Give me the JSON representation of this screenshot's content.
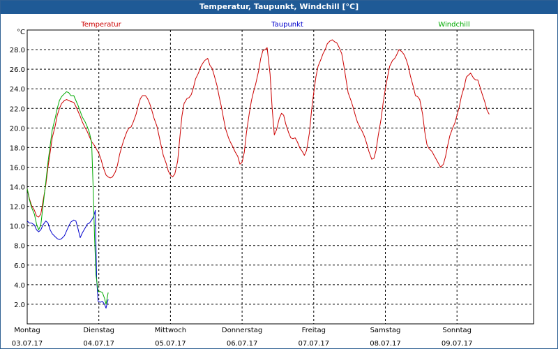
{
  "window": {
    "title": "Temperatur, Taupunkt, Windchill [°C]"
  },
  "chart_data": {
    "type": "line",
    "title": "Temperatur, Taupunkt, Windchill [°C]",
    "ylabel": "°C",
    "ylim": [
      0,
      30
    ],
    "xlim": [
      0,
      7
    ],
    "grid": true,
    "legend_position": "top",
    "y_ticks": [
      "2.0",
      "4.0",
      "6.0",
      "8.0",
      "10.0",
      "12.0",
      "14.0",
      "16.0",
      "18.0",
      "20.0",
      "22.0",
      "24.0",
      "26.0",
      "28.0"
    ],
    "x_ticks": [
      {
        "day": "Montag",
        "date": "03.07.17"
      },
      {
        "day": "Dienstag",
        "date": "04.07.17"
      },
      {
        "day": "Mittwoch",
        "date": "05.07.17"
      },
      {
        "day": "Donnerstag",
        "date": "06.07.17"
      },
      {
        "day": "Freitag",
        "date": "07.07.17"
      },
      {
        "day": "Samstag",
        "date": "08.07.17"
      },
      {
        "day": "Sonntag",
        "date": "09.07.17"
      }
    ],
    "series": [
      {
        "name": "Temperatur",
        "color": "#cc0000",
        "points": [
          [
            0.0,
            13.8
          ],
          [
            0.03,
            12.8
          ],
          [
            0.06,
            12.1
          ],
          [
            0.1,
            11.6
          ],
          [
            0.13,
            11.0
          ],
          [
            0.16,
            10.9
          ],
          [
            0.19,
            11.2
          ],
          [
            0.22,
            12.5
          ],
          [
            0.26,
            14.2
          ],
          [
            0.29,
            16.0
          ],
          [
            0.32,
            17.5
          ],
          [
            0.35,
            19.0
          ],
          [
            0.39,
            20.2
          ],
          [
            0.42,
            21.3
          ],
          [
            0.45,
            22.0
          ],
          [
            0.48,
            22.5
          ],
          [
            0.52,
            22.8
          ],
          [
            0.55,
            22.9
          ],
          [
            0.58,
            22.8
          ],
          [
            0.61,
            22.7
          ],
          [
            0.65,
            22.6
          ],
          [
            0.68,
            22.2
          ],
          [
            0.71,
            21.7
          ],
          [
            0.74,
            21.2
          ],
          [
            0.77,
            20.6
          ],
          [
            0.81,
            20.0
          ],
          [
            0.84,
            19.6
          ],
          [
            0.87,
            19.1
          ],
          [
            0.9,
            18.6
          ],
          [
            0.94,
            18.2
          ],
          [
            0.97,
            17.8
          ],
          [
            1.0,
            17.4
          ],
          [
            1.03,
            16.8
          ],
          [
            1.06,
            16.0
          ],
          [
            1.1,
            15.2
          ],
          [
            1.13,
            15.0
          ],
          [
            1.16,
            14.9
          ],
          [
            1.19,
            15.0
          ],
          [
            1.23,
            15.5
          ],
          [
            1.26,
            16.2
          ],
          [
            1.29,
            17.3
          ],
          [
            1.32,
            18.1
          ],
          [
            1.35,
            18.8
          ],
          [
            1.39,
            19.6
          ],
          [
            1.42,
            20.0
          ],
          [
            1.45,
            20.1
          ],
          [
            1.48,
            20.6
          ],
          [
            1.52,
            21.4
          ],
          [
            1.55,
            22.3
          ],
          [
            1.58,
            23.0
          ],
          [
            1.61,
            23.3
          ],
          [
            1.65,
            23.3
          ],
          [
            1.68,
            23.0
          ],
          [
            1.71,
            22.5
          ],
          [
            1.74,
            21.8
          ],
          [
            1.77,
            21.0
          ],
          [
            1.81,
            20.2
          ],
          [
            1.84,
            19.2
          ],
          [
            1.87,
            18.2
          ],
          [
            1.9,
            17.2
          ],
          [
            1.94,
            16.4
          ],
          [
            1.97,
            15.6
          ],
          [
            2.0,
            15.2
          ],
          [
            2.03,
            15.0
          ],
          [
            2.06,
            15.3
          ],
          [
            2.1,
            16.6
          ],
          [
            2.13,
            19.0
          ],
          [
            2.16,
            21.2
          ],
          [
            2.19,
            22.5
          ],
          [
            2.23,
            23.0
          ],
          [
            2.26,
            23.1
          ],
          [
            2.29,
            23.4
          ],
          [
            2.32,
            24.1
          ],
          [
            2.35,
            25.0
          ],
          [
            2.39,
            25.6
          ],
          [
            2.42,
            26.2
          ],
          [
            2.45,
            26.6
          ],
          [
            2.48,
            26.9
          ],
          [
            2.52,
            27.1
          ],
          [
            2.55,
            26.4
          ],
          [
            2.58,
            26.1
          ],
          [
            2.61,
            25.4
          ],
          [
            2.65,
            24.3
          ],
          [
            2.68,
            23.2
          ],
          [
            2.71,
            22.2
          ],
          [
            2.74,
            21.0
          ],
          [
            2.77,
            19.9
          ],
          [
            2.81,
            19.0
          ],
          [
            2.84,
            18.5
          ],
          [
            2.87,
            18.1
          ],
          [
            2.9,
            17.6
          ],
          [
            2.94,
            17.1
          ],
          [
            2.97,
            16.3
          ],
          [
            3.0,
            16.5
          ],
          [
            3.03,
            17.5
          ],
          [
            3.06,
            19.5
          ],
          [
            3.1,
            21.5
          ],
          [
            3.13,
            22.8
          ],
          [
            3.16,
            23.7
          ],
          [
            3.19,
            24.5
          ],
          [
            3.23,
            25.8
          ],
          [
            3.26,
            27.1
          ],
          [
            3.29,
            27.9
          ],
          [
            3.32,
            28.0
          ],
          [
            3.35,
            28.2
          ],
          [
            3.39,
            25.5
          ],
          [
            3.42,
            22.0
          ],
          [
            3.45,
            19.3
          ],
          [
            3.48,
            19.8
          ],
          [
            3.52,
            21.0
          ],
          [
            3.55,
            21.5
          ],
          [
            3.58,
            21.3
          ],
          [
            3.61,
            20.4
          ],
          [
            3.65,
            19.5
          ],
          [
            3.68,
            19.0
          ],
          [
            3.71,
            18.9
          ],
          [
            3.74,
            19.0
          ],
          [
            3.77,
            18.6
          ],
          [
            3.81,
            17.9
          ],
          [
            3.84,
            17.6
          ],
          [
            3.87,
            17.2
          ],
          [
            3.9,
            17.7
          ],
          [
            3.94,
            19.5
          ],
          [
            3.97,
            21.8
          ],
          [
            4.0,
            23.6
          ],
          [
            4.03,
            25.2
          ],
          [
            4.06,
            26.3
          ],
          [
            4.1,
            27.0
          ],
          [
            4.13,
            27.6
          ],
          [
            4.16,
            28.0
          ],
          [
            4.19,
            28.6
          ],
          [
            4.23,
            28.9
          ],
          [
            4.26,
            29.0
          ],
          [
            4.29,
            28.8
          ],
          [
            4.32,
            28.7
          ],
          [
            4.35,
            28.3
          ],
          [
            4.39,
            27.6
          ],
          [
            4.42,
            26.4
          ],
          [
            4.45,
            25.0
          ],
          [
            4.48,
            23.6
          ],
          [
            4.52,
            22.8
          ],
          [
            4.55,
            22.1
          ],
          [
            4.58,
            21.3
          ],
          [
            4.61,
            20.6
          ],
          [
            4.65,
            20.0
          ],
          [
            4.68,
            19.6
          ],
          [
            4.71,
            19.1
          ],
          [
            4.74,
            18.4
          ],
          [
            4.77,
            17.6
          ],
          [
            4.81,
            16.8
          ],
          [
            4.84,
            16.9
          ],
          [
            4.87,
            17.7
          ],
          [
            4.9,
            19.2
          ],
          [
            4.94,
            20.9
          ],
          [
            4.97,
            22.6
          ],
          [
            5.0,
            24.0
          ],
          [
            5.03,
            25.2
          ],
          [
            5.06,
            26.3
          ],
          [
            5.1,
            26.9
          ],
          [
            5.13,
            27.1
          ],
          [
            5.16,
            27.5
          ],
          [
            5.19,
            28.0
          ],
          [
            5.23,
            27.8
          ],
          [
            5.26,
            27.5
          ],
          [
            5.29,
            27.0
          ],
          [
            5.32,
            26.3
          ],
          [
            5.35,
            25.3
          ],
          [
            5.39,
            24.2
          ],
          [
            5.42,
            23.3
          ],
          [
            5.45,
            23.2
          ],
          [
            5.48,
            22.9
          ],
          [
            5.52,
            21.4
          ],
          [
            5.55,
            19.6
          ],
          [
            5.58,
            18.3
          ],
          [
            5.61,
            17.9
          ],
          [
            5.65,
            17.6
          ],
          [
            5.68,
            17.2
          ],
          [
            5.71,
            16.8
          ],
          [
            5.74,
            16.4
          ],
          [
            5.77,
            16.0
          ],
          [
            5.81,
            16.3
          ],
          [
            5.84,
            17.1
          ],
          [
            5.87,
            18.2
          ],
          [
            5.9,
            19.2
          ],
          [
            5.94,
            20.0
          ],
          [
            5.97,
            20.5
          ],
          [
            6.0,
            21.3
          ],
          [
            6.03,
            22.1
          ],
          [
            6.06,
            23.2
          ],
          [
            6.1,
            24.2
          ],
          [
            6.13,
            25.2
          ],
          [
            6.16,
            25.4
          ],
          [
            6.19,
            25.6
          ],
          [
            6.23,
            25.1
          ],
          [
            6.26,
            24.9
          ],
          [
            6.29,
            24.9
          ],
          [
            6.32,
            24.2
          ],
          [
            6.35,
            23.5
          ],
          [
            6.39,
            22.6
          ],
          [
            6.42,
            21.8
          ],
          [
            6.45,
            21.4
          ]
        ]
      },
      {
        "name": "Taupunkt",
        "color": "#0000cc",
        "points": [
          [
            0.0,
            10.5
          ],
          [
            0.03,
            10.3
          ],
          [
            0.06,
            10.3
          ],
          [
            0.1,
            10.1
          ],
          [
            0.13,
            9.6
          ],
          [
            0.16,
            9.4
          ],
          [
            0.19,
            9.6
          ],
          [
            0.22,
            10.1
          ],
          [
            0.26,
            10.5
          ],
          [
            0.29,
            10.3
          ],
          [
            0.32,
            9.6
          ],
          [
            0.35,
            9.2
          ],
          [
            0.39,
            8.9
          ],
          [
            0.42,
            8.7
          ],
          [
            0.45,
            8.6
          ],
          [
            0.48,
            8.7
          ],
          [
            0.52,
            9.0
          ],
          [
            0.55,
            9.5
          ],
          [
            0.58,
            10.0
          ],
          [
            0.61,
            10.4
          ],
          [
            0.65,
            10.6
          ],
          [
            0.68,
            10.5
          ],
          [
            0.71,
            9.7
          ],
          [
            0.74,
            8.8
          ],
          [
            0.77,
            9.3
          ],
          [
            0.81,
            9.8
          ],
          [
            0.84,
            10.2
          ],
          [
            0.87,
            10.3
          ],
          [
            0.9,
            10.6
          ],
          [
            0.93,
            11.0
          ],
          [
            0.95,
            11.6
          ],
          [
            0.97,
            4.5
          ],
          [
            0.99,
            2.3
          ],
          [
            1.02,
            2.2
          ],
          [
            1.05,
            2.3
          ],
          [
            1.08,
            2.0
          ],
          [
            1.1,
            1.6
          ],
          [
            1.13,
            2.5
          ]
        ]
      },
      {
        "name": "Windchill",
        "color": "#00aa00",
        "points": [
          [
            0.0,
            13.8
          ],
          [
            0.03,
            12.7
          ],
          [
            0.06,
            11.9
          ],
          [
            0.1,
            11.2
          ],
          [
            0.13,
            10.2
          ],
          [
            0.16,
            9.6
          ],
          [
            0.19,
            10.1
          ],
          [
            0.22,
            12.0
          ],
          [
            0.26,
            14.5
          ],
          [
            0.29,
            16.5
          ],
          [
            0.32,
            18.2
          ],
          [
            0.35,
            19.8
          ],
          [
            0.39,
            21.0
          ],
          [
            0.42,
            22.0
          ],
          [
            0.45,
            22.8
          ],
          [
            0.48,
            23.2
          ],
          [
            0.52,
            23.5
          ],
          [
            0.55,
            23.7
          ],
          [
            0.58,
            23.6
          ],
          [
            0.61,
            23.3
          ],
          [
            0.65,
            23.3
          ],
          [
            0.68,
            22.8
          ],
          [
            0.71,
            22.3
          ],
          [
            0.74,
            21.7
          ],
          [
            0.77,
            21.1
          ],
          [
            0.81,
            20.6
          ],
          [
            0.84,
            20.1
          ],
          [
            0.87,
            19.5
          ],
          [
            0.9,
            18.5
          ],
          [
            0.92,
            14.0
          ],
          [
            0.94,
            9.0
          ],
          [
            0.96,
            5.0
          ],
          [
            0.99,
            3.3
          ],
          [
            1.02,
            3.3
          ],
          [
            1.05,
            3.2
          ],
          [
            1.08,
            2.6
          ],
          [
            1.1,
            2.0
          ],
          [
            1.13,
            3.2
          ]
        ]
      }
    ]
  }
}
